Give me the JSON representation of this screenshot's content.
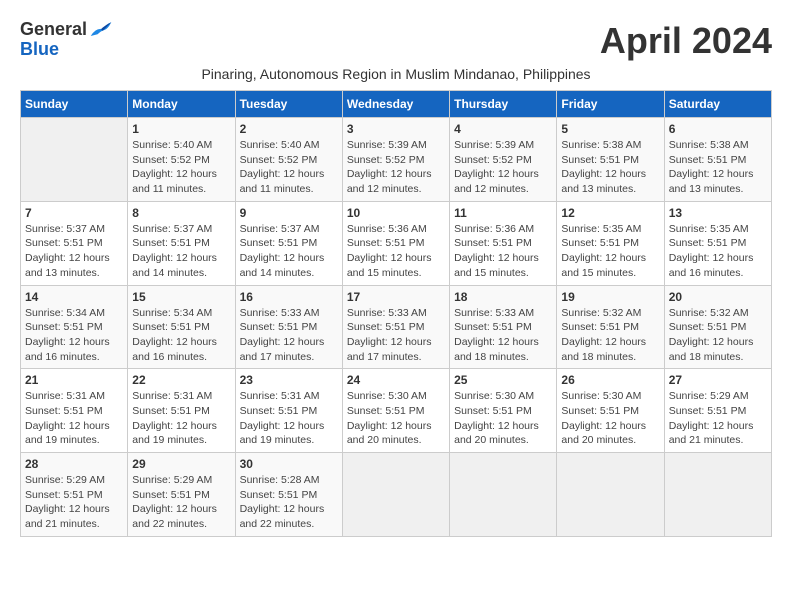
{
  "header": {
    "logo_line1": "General",
    "logo_line2": "Blue",
    "title": "April 2024",
    "subtitle": "Pinaring, Autonomous Region in Muslim Mindanao, Philippines"
  },
  "days_of_week": [
    "Sunday",
    "Monday",
    "Tuesday",
    "Wednesday",
    "Thursday",
    "Friday",
    "Saturday"
  ],
  "weeks": [
    [
      {
        "day": "",
        "info": ""
      },
      {
        "day": "1",
        "info": "Sunrise: 5:40 AM\nSunset: 5:52 PM\nDaylight: 12 hours\nand 11 minutes."
      },
      {
        "day": "2",
        "info": "Sunrise: 5:40 AM\nSunset: 5:52 PM\nDaylight: 12 hours\nand 11 minutes."
      },
      {
        "day": "3",
        "info": "Sunrise: 5:39 AM\nSunset: 5:52 PM\nDaylight: 12 hours\nand 12 minutes."
      },
      {
        "day": "4",
        "info": "Sunrise: 5:39 AM\nSunset: 5:52 PM\nDaylight: 12 hours\nand 12 minutes."
      },
      {
        "day": "5",
        "info": "Sunrise: 5:38 AM\nSunset: 5:51 PM\nDaylight: 12 hours\nand 13 minutes."
      },
      {
        "day": "6",
        "info": "Sunrise: 5:38 AM\nSunset: 5:51 PM\nDaylight: 12 hours\nand 13 minutes."
      }
    ],
    [
      {
        "day": "7",
        "info": "Sunrise: 5:37 AM\nSunset: 5:51 PM\nDaylight: 12 hours\nand 13 minutes."
      },
      {
        "day": "8",
        "info": "Sunrise: 5:37 AM\nSunset: 5:51 PM\nDaylight: 12 hours\nand 14 minutes."
      },
      {
        "day": "9",
        "info": "Sunrise: 5:37 AM\nSunset: 5:51 PM\nDaylight: 12 hours\nand 14 minutes."
      },
      {
        "day": "10",
        "info": "Sunrise: 5:36 AM\nSunset: 5:51 PM\nDaylight: 12 hours\nand 15 minutes."
      },
      {
        "day": "11",
        "info": "Sunrise: 5:36 AM\nSunset: 5:51 PM\nDaylight: 12 hours\nand 15 minutes."
      },
      {
        "day": "12",
        "info": "Sunrise: 5:35 AM\nSunset: 5:51 PM\nDaylight: 12 hours\nand 15 minutes."
      },
      {
        "day": "13",
        "info": "Sunrise: 5:35 AM\nSunset: 5:51 PM\nDaylight: 12 hours\nand 16 minutes."
      }
    ],
    [
      {
        "day": "14",
        "info": "Sunrise: 5:34 AM\nSunset: 5:51 PM\nDaylight: 12 hours\nand 16 minutes."
      },
      {
        "day": "15",
        "info": "Sunrise: 5:34 AM\nSunset: 5:51 PM\nDaylight: 12 hours\nand 16 minutes."
      },
      {
        "day": "16",
        "info": "Sunrise: 5:33 AM\nSunset: 5:51 PM\nDaylight: 12 hours\nand 17 minutes."
      },
      {
        "day": "17",
        "info": "Sunrise: 5:33 AM\nSunset: 5:51 PM\nDaylight: 12 hours\nand 17 minutes."
      },
      {
        "day": "18",
        "info": "Sunrise: 5:33 AM\nSunset: 5:51 PM\nDaylight: 12 hours\nand 18 minutes."
      },
      {
        "day": "19",
        "info": "Sunrise: 5:32 AM\nSunset: 5:51 PM\nDaylight: 12 hours\nand 18 minutes."
      },
      {
        "day": "20",
        "info": "Sunrise: 5:32 AM\nSunset: 5:51 PM\nDaylight: 12 hours\nand 18 minutes."
      }
    ],
    [
      {
        "day": "21",
        "info": "Sunrise: 5:31 AM\nSunset: 5:51 PM\nDaylight: 12 hours\nand 19 minutes."
      },
      {
        "day": "22",
        "info": "Sunrise: 5:31 AM\nSunset: 5:51 PM\nDaylight: 12 hours\nand 19 minutes."
      },
      {
        "day": "23",
        "info": "Sunrise: 5:31 AM\nSunset: 5:51 PM\nDaylight: 12 hours\nand 19 minutes."
      },
      {
        "day": "24",
        "info": "Sunrise: 5:30 AM\nSunset: 5:51 PM\nDaylight: 12 hours\nand 20 minutes."
      },
      {
        "day": "25",
        "info": "Sunrise: 5:30 AM\nSunset: 5:51 PM\nDaylight: 12 hours\nand 20 minutes."
      },
      {
        "day": "26",
        "info": "Sunrise: 5:30 AM\nSunset: 5:51 PM\nDaylight: 12 hours\nand 20 minutes."
      },
      {
        "day": "27",
        "info": "Sunrise: 5:29 AM\nSunset: 5:51 PM\nDaylight: 12 hours\nand 21 minutes."
      }
    ],
    [
      {
        "day": "28",
        "info": "Sunrise: 5:29 AM\nSunset: 5:51 PM\nDaylight: 12 hours\nand 21 minutes."
      },
      {
        "day": "29",
        "info": "Sunrise: 5:29 AM\nSunset: 5:51 PM\nDaylight: 12 hours\nand 22 minutes."
      },
      {
        "day": "30",
        "info": "Sunrise: 5:28 AM\nSunset: 5:51 PM\nDaylight: 12 hours\nand 22 minutes."
      },
      {
        "day": "",
        "info": ""
      },
      {
        "day": "",
        "info": ""
      },
      {
        "day": "",
        "info": ""
      },
      {
        "day": "",
        "info": ""
      }
    ]
  ]
}
